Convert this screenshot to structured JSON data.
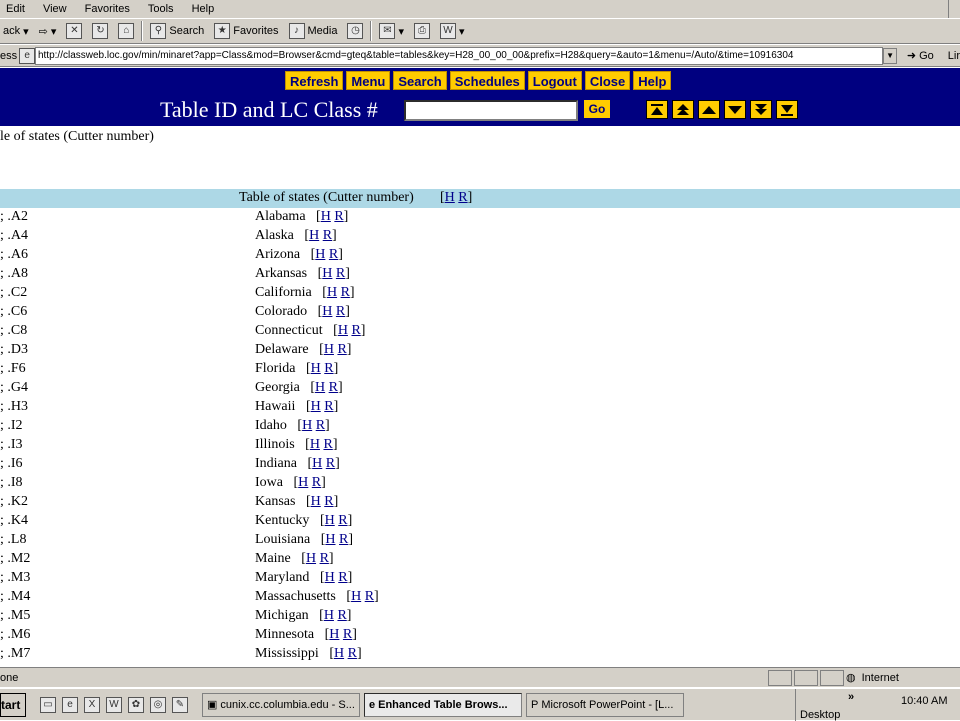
{
  "menubar": {
    "items": [
      "Edit",
      "View",
      "Favorites",
      "Tools",
      "Help"
    ]
  },
  "toolbar": {
    "back": "ack",
    "search": "Search",
    "favorites": "Favorites",
    "media": "Media"
  },
  "address": {
    "label": "ess",
    "url": "http://classweb.loc.gov/min/minaret?app=Class&mod=Browser&cmd=gteq&table=tables&key=H28_00_00_00&prefix=H28&query=&auto=1&menu=/Auto/&time=10916304",
    "go": "Go",
    "links": "Lir"
  },
  "nav": {
    "buttons": [
      "Refresh",
      "Menu",
      "Search",
      "Schedules",
      "Logout",
      "Close",
      "Help"
    ],
    "table_id_label": "Table ID and LC Class #",
    "go": "Go",
    "table_id_value": ""
  },
  "breadcrumb": "le of states (Cutter number)",
  "table": {
    "header": {
      "title": "Table of states (Cutter number)",
      "h": "H",
      "r": "R"
    },
    "rows": [
      {
        "code": "; .A2",
        "state": "Alabama"
      },
      {
        "code": "; .A4",
        "state": "Alaska"
      },
      {
        "code": "; .A6",
        "state": "Arizona"
      },
      {
        "code": "; .A8",
        "state": "Arkansas"
      },
      {
        "code": "; .C2",
        "state": "California"
      },
      {
        "code": "; .C6",
        "state": "Colorado"
      },
      {
        "code": "; .C8",
        "state": "Connecticut"
      },
      {
        "code": "; .D3",
        "state": "Delaware"
      },
      {
        "code": "; .F6",
        "state": "Florida"
      },
      {
        "code": "; .G4",
        "state": "Georgia"
      },
      {
        "code": "; .H3",
        "state": "Hawaii"
      },
      {
        "code": "; .I2",
        "state": "Idaho"
      },
      {
        "code": "; .I3",
        "state": "Illinois"
      },
      {
        "code": "; .I6",
        "state": "Indiana"
      },
      {
        "code": "; .I8",
        "state": "Iowa"
      },
      {
        "code": "; .K2",
        "state": "Kansas"
      },
      {
        "code": "; .K4",
        "state": "Kentucky"
      },
      {
        "code": "; .L8",
        "state": "Louisiana"
      },
      {
        "code": "; .M2",
        "state": "Maine"
      },
      {
        "code": "; .M3",
        "state": "Maryland"
      },
      {
        "code": "; .M4",
        "state": "Massachusetts"
      },
      {
        "code": "; .M5",
        "state": "Michigan"
      },
      {
        "code": "; .M6",
        "state": "Minnesota"
      },
      {
        "code": "; .M7",
        "state": "Mississippi"
      }
    ]
  },
  "status": {
    "text": "one",
    "zone": "Internet"
  },
  "taskbar": {
    "start": "tart",
    "buttons": [
      "cunix.cc.columbia.edu - S...",
      "Enhanced Table Brows...",
      "Microsoft PowerPoint - [L..."
    ],
    "active_index": 1,
    "desktop": "Desktop",
    "clock": "10:40 AM"
  },
  "colors": {
    "nav_bg": "#000080",
    "button_bg": "#ffcc00",
    "table_header_bg": "#add8e6",
    "link": "#00008b"
  }
}
